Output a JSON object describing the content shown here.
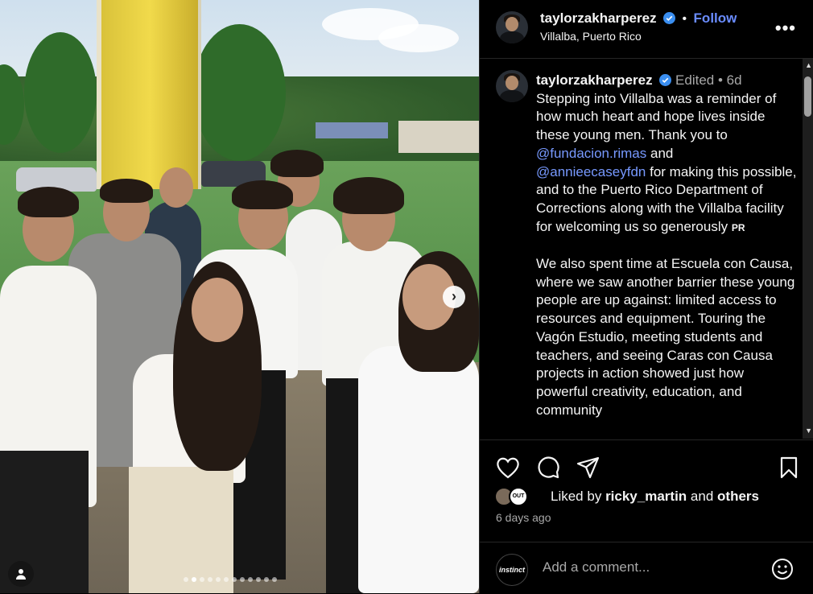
{
  "post": {
    "author": "taylorzakharperez",
    "follow_label": "Follow",
    "separator": "•",
    "location": "Villalba, Puerto Rico",
    "more_label": "•••",
    "carousel_next": "›"
  },
  "caption": {
    "author": "taylorzakharperez",
    "edited": "Edited",
    "separator": "•",
    "age": "6d",
    "text_1": "Stepping into Villalba was a reminder of how much heart and hope lives inside these young men. Thank you to",
    "mention_1": "@fundacion.rimas",
    "and_1": "and",
    "mention_2": "@annieecaseyfdn",
    "text_2": "for making this possible, and to the Puerto Rico Department of Corrections along with the Villalba facility for welcoming us so generously",
    "flag": "PR",
    "paragraph_2": "We also spent time at Escuela con Causa, where we saw another barrier these young people are up against: limited access to resources and equipment. Touring the Vagón Estudio, meeting students and teachers, and seeing Caras con Causa projects in action showed just how powerful creativity, education, and community"
  },
  "engagement": {
    "liked_by_prefix": "Liked by",
    "liked_by_user": "ricky_martin",
    "liked_by_and": "and",
    "liked_by_others": "others",
    "liker_badge": "OUT",
    "timestamp": "6 days ago"
  },
  "comment": {
    "avatar_text": "instinct",
    "placeholder": "Add a comment..."
  },
  "colors": {
    "background": "#000000",
    "link": "#6a8cff",
    "verified": "#3a8ef0",
    "muted": "#a8a8a8"
  },
  "icons": [
    "person-tag-icon",
    "chevron-right-icon",
    "verified-icon",
    "more-icon",
    "heart-icon",
    "comment-icon",
    "share-icon",
    "bookmark-icon",
    "emoji-icon"
  ]
}
